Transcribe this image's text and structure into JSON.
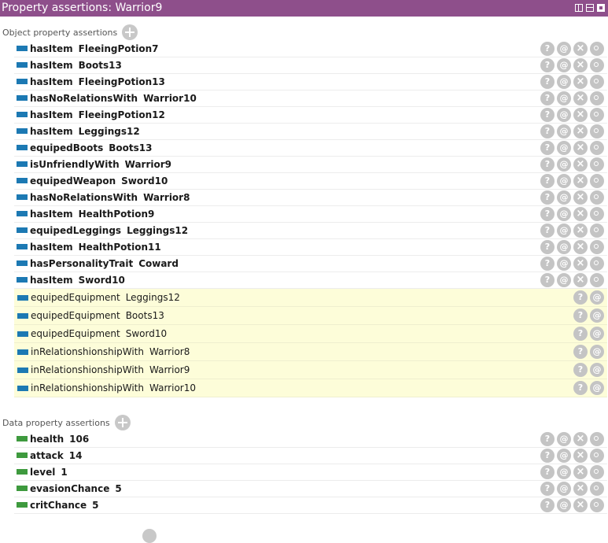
{
  "window": {
    "title": "Property assertions: Warrior9"
  },
  "object_section": {
    "label": "Object property assertions",
    "asserted": [
      {
        "property": "hasItem",
        "value": "FleeingPotion7"
      },
      {
        "property": "hasItem",
        "value": "Boots13"
      },
      {
        "property": "hasItem",
        "value": "FleeingPotion13"
      },
      {
        "property": "hasNoRelationsWith",
        "value": "Warrior10"
      },
      {
        "property": "hasItem",
        "value": "FleeingPotion12"
      },
      {
        "property": "hasItem",
        "value": "Leggings12"
      },
      {
        "property": "equipedBoots",
        "value": "Boots13"
      },
      {
        "property": "isUnfriendlyWith",
        "value": "Warrior9"
      },
      {
        "property": "equipedWeapon",
        "value": "Sword10"
      },
      {
        "property": "hasNoRelationsWith",
        "value": "Warrior8"
      },
      {
        "property": "hasItem",
        "value": "HealthPotion9"
      },
      {
        "property": "equipedLeggings",
        "value": "Leggings12"
      },
      {
        "property": "hasItem",
        "value": "HealthPotion11"
      },
      {
        "property": "hasPersonalityTrait",
        "value": "Coward"
      },
      {
        "property": "hasItem",
        "value": "Sword10"
      }
    ],
    "inferred": [
      {
        "property": "equipedEquipment",
        "value": "Leggings12"
      },
      {
        "property": "equipedEquipment",
        "value": "Boots13"
      },
      {
        "property": "equipedEquipment",
        "value": "Sword10"
      },
      {
        "property": "inRelationshionshipWith",
        "value": "Warrior8"
      },
      {
        "property": "inRelationshionshipWith",
        "value": "Warrior9"
      },
      {
        "property": "inRelationshionshipWith",
        "value": "Warrior10"
      }
    ]
  },
  "data_section": {
    "label": "Data property assertions",
    "asserted": [
      {
        "property": "health",
        "value": "106"
      },
      {
        "property": "attack",
        "value": "14"
      },
      {
        "property": "level",
        "value": "1"
      },
      {
        "property": "evasionChance",
        "value": "5"
      },
      {
        "property": "critChance",
        "value": "5"
      }
    ]
  },
  "buttons": {
    "explain": "?",
    "annotate": "@",
    "delete": "×"
  },
  "colors": {
    "titlebar": "#8e4f8b",
    "object_swatch": "#1c79b3",
    "data_swatch": "#3e9a3e",
    "inferred_bg": "#fdfdd9",
    "button": "#c4c4c4"
  },
  "icons": [
    "view-split-vertical-icon",
    "view-split-horizontal-icon",
    "view-maximize-icon",
    "add-icon",
    "explain-icon",
    "annotate-icon",
    "delete-icon",
    "edit-icon"
  ]
}
